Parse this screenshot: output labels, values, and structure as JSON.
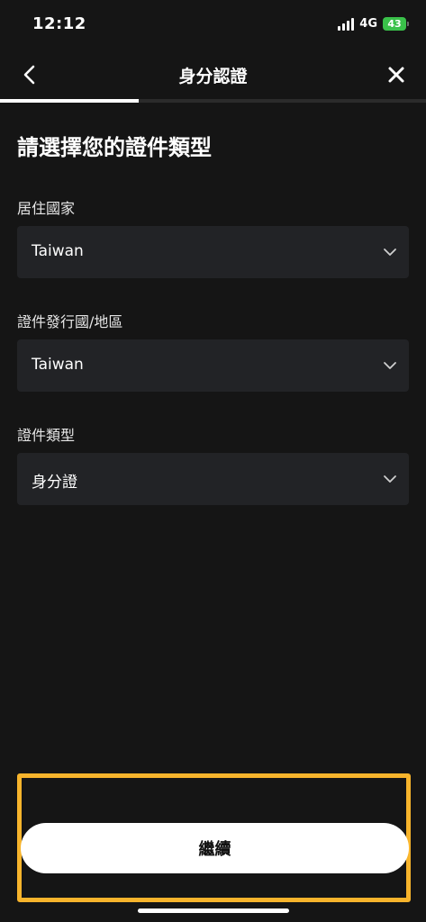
{
  "status_bar": {
    "time": "12:12",
    "network": "4G",
    "battery": "43"
  },
  "header": {
    "title": "身分認證",
    "back_icon": "chevron-left-icon",
    "close_icon": "close-icon",
    "progress": 0.325
  },
  "main": {
    "heading": "請選擇您的證件類型",
    "fields": [
      {
        "label": "居住國家",
        "value": "Taiwan"
      },
      {
        "label": "證件發行國/地區",
        "value": "Taiwan"
      },
      {
        "label": "證件類型",
        "value": "身分證"
      }
    ]
  },
  "footer": {
    "continue_label": "繼續",
    "highlight_color": "#f7b42c"
  }
}
